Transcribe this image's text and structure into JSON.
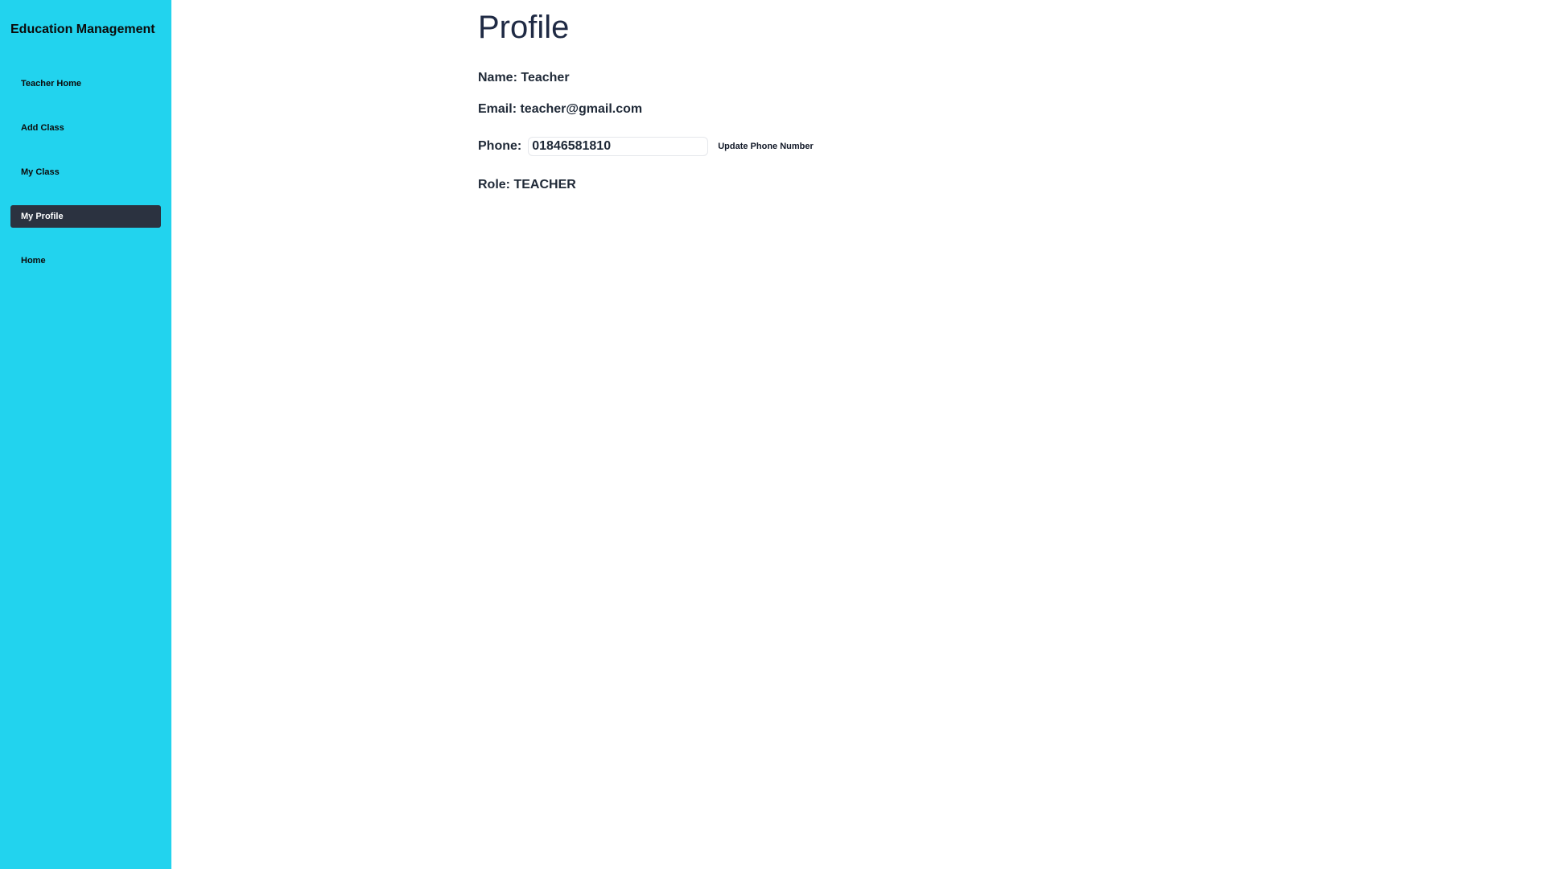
{
  "sidebar": {
    "brand": "Education Management",
    "items": [
      {
        "label": "Teacher Home",
        "active": false
      },
      {
        "label": "Add Class",
        "active": false
      },
      {
        "label": "My Class",
        "active": false
      },
      {
        "label": "My Profile",
        "active": true
      },
      {
        "label": "Home",
        "active": false
      }
    ]
  },
  "profile": {
    "title": "Profile",
    "name_label": "Name:",
    "name_value": "Teacher",
    "email_label": "Email:",
    "email_value": "teacher@gmail.com",
    "phone_label": "Phone:",
    "phone_value": "01846581810",
    "update_button": "Update Phone Number",
    "role_label": "Role:",
    "role_value": "TEACHER"
  },
  "colors": {
    "sidebar_bg": "#22d3ee",
    "active_item_bg": "#2b3240",
    "text": "#1f2937"
  }
}
